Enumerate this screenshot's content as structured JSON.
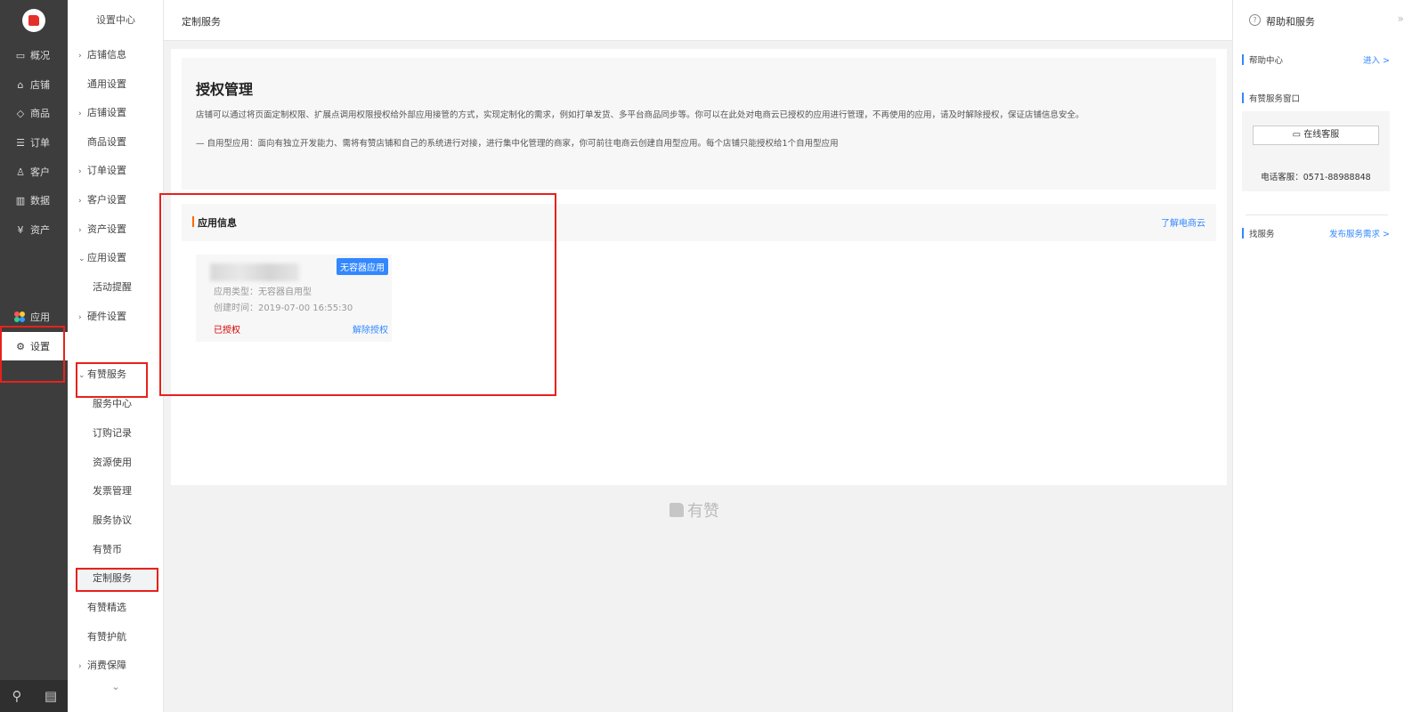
{
  "nav1": {
    "items": [
      {
        "label": "概况",
        "icon": "monitor-icon"
      },
      {
        "label": "店铺",
        "icon": "store-icon"
      },
      {
        "label": "商品",
        "icon": "tag-icon"
      },
      {
        "label": "订单",
        "icon": "order-icon"
      },
      {
        "label": "客户",
        "icon": "user-icon"
      },
      {
        "label": "数据",
        "icon": "bar-chart-icon"
      },
      {
        "label": "资产",
        "icon": "yen-icon"
      }
    ],
    "app_label": "应用",
    "settings_label": "设置"
  },
  "nav2": {
    "title": "设置中心",
    "items": [
      {
        "label": "店铺信息",
        "kind": "group"
      },
      {
        "label": "通用设置",
        "kind": "sub2"
      },
      {
        "label": "店铺设置",
        "kind": "group"
      },
      {
        "label": "商品设置",
        "kind": "sub2"
      },
      {
        "label": "订单设置",
        "kind": "group"
      },
      {
        "label": "客户设置",
        "kind": "group"
      },
      {
        "label": "资产设置",
        "kind": "group"
      },
      {
        "label": "应用设置",
        "kind": "group-open"
      },
      {
        "label": "活动提醒",
        "kind": "sub"
      },
      {
        "label": "硬件设置",
        "kind": "group"
      },
      {
        "label": "有赞服务",
        "kind": "group-open"
      },
      {
        "label": "服务中心",
        "kind": "sub"
      },
      {
        "label": "订购记录",
        "kind": "sub"
      },
      {
        "label": "资源使用",
        "kind": "sub"
      },
      {
        "label": "发票管理",
        "kind": "sub"
      },
      {
        "label": "服务协议",
        "kind": "sub"
      },
      {
        "label": "有赞币",
        "kind": "sub"
      },
      {
        "label": "定制服务",
        "kind": "current"
      },
      {
        "label": "有赞精选",
        "kind": "sub2"
      },
      {
        "label": "有赞护航",
        "kind": "sub2"
      },
      {
        "label": "消费保障",
        "kind": "group"
      }
    ]
  },
  "topbar": {
    "title": "定制服务"
  },
  "intro": {
    "title": "授权管理",
    "desc1": "店铺可以通过将页面定制权限、扩展点调用权限授权给外部应用接管的方式，实现定制化的需求，例如打单发货、多平台商品同步等。你可以在此处对电商云已授权的应用进行管理，不再使用的应用，请及时解除授权，保证店铺信息安全。",
    "desc2": "— 自用型应用：面向有独立开发能力、需将有赞店铺和自己的系统进行对接，进行集中化管理的商家，你可前往电商云创建自用型应用。每个店铺只能授权给1个自用型应用"
  },
  "section": {
    "title": "应用信息",
    "link": "了解电商云"
  },
  "app": {
    "tag": "无容器应用",
    "type": "应用类型：无容器自用型",
    "created": "创建时间：2019-07-00 16:55:30",
    "status": "已授权",
    "action": "解除授权"
  },
  "footer": {
    "brand": "有赞"
  },
  "right": {
    "title": "帮助和服务",
    "help_center": "帮助中心",
    "enter": "进入 >",
    "service_window": "有赞服务窗口",
    "online_service": "在线客服",
    "phone": "电话客服：0571-88988848",
    "feedback": "找服务",
    "feedback_link": "发布服务需求 >"
  },
  "colors": {
    "accent": "#3388ff",
    "highlight": "#e8211c",
    "sidebar": "#3d3d3d"
  }
}
